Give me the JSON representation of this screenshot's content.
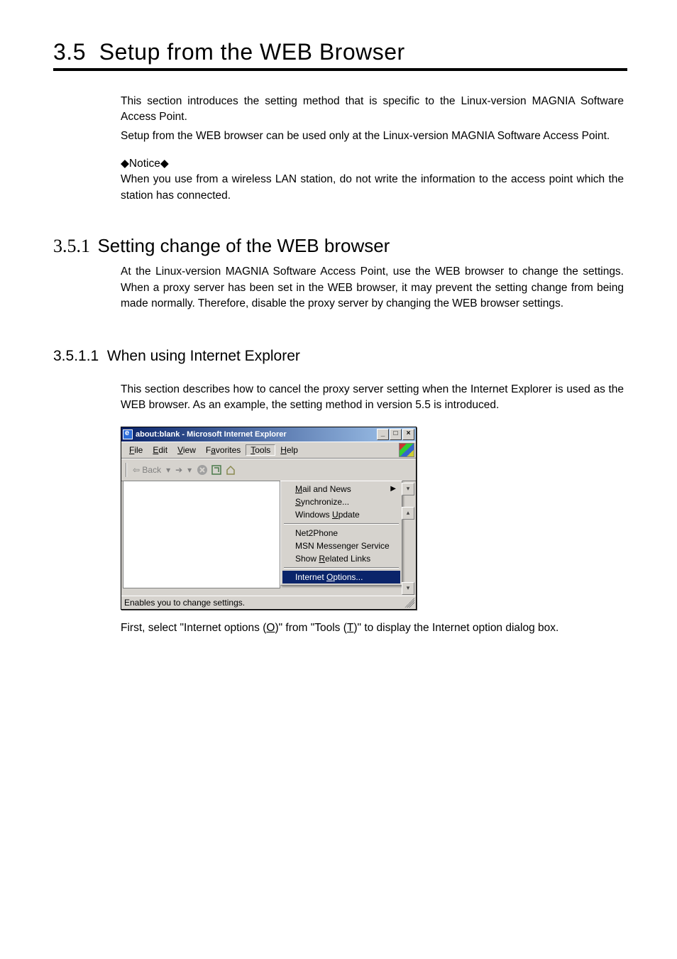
{
  "section": {
    "number": "3.5",
    "title": "Setup from the WEB Browser",
    "intro_p1": "This section introduces the setting method that is specific to the Linux-version MAGNIA Software Access Point.",
    "intro_p2": "Setup from the WEB browser can be used only at the Linux-version MAGNIA Software Access Point.",
    "notice_label": "◆Notice◆",
    "notice_text": "When you use from a wireless LAN station, do not write the information to the access point which the station has connected."
  },
  "sub1": {
    "number": "3.5.1",
    "title": "Setting change of the WEB browser",
    "para": "At the Linux-version MAGNIA Software Access Point, use the WEB browser to change the settings.  When a proxy server has been set in the WEB browser, it may prevent the setting change from being made normally.  Therefore, disable the proxy server by changing the WEB browser settings."
  },
  "sub2": {
    "number": "3.5.1.1",
    "title": "When using Internet Explorer",
    "para": "This section describes how to cancel the proxy server setting when the Internet Explorer is used as the WEB browser.   As an example, the setting method in version 5.5 is introduced."
  },
  "ie": {
    "title": "about:blank - Microsoft Internet Explorer",
    "menus": {
      "file": "File",
      "file_u": "F",
      "edit": "Edit",
      "edit_u": "E",
      "view": "View",
      "view_u": "V",
      "favorites": "Favorites",
      "favorites_u": "a",
      "tools": "Tools",
      "tools_u": "T",
      "help": "Help",
      "help_u": "H"
    },
    "toolbar": {
      "back": "Back"
    },
    "tools_menu": {
      "mail": "Mail and News",
      "mail_u": "M",
      "sync": "Synchronize...",
      "sync_u": "S",
      "update": "Windows Update",
      "update_u": "U",
      "net2phone": "Net2Phone",
      "msn": "MSN Messenger Service",
      "related": "Show Related Links",
      "related_u": "R",
      "options": "Internet Options...",
      "options_u": "O"
    },
    "status": "Enables you to change settings."
  },
  "caption": {
    "pre": "First, select \"Internet options (",
    "o": "O",
    "mid": ")\" from \"Tools (",
    "t": "T",
    "post": ")\" to display the Internet option dialog box."
  }
}
